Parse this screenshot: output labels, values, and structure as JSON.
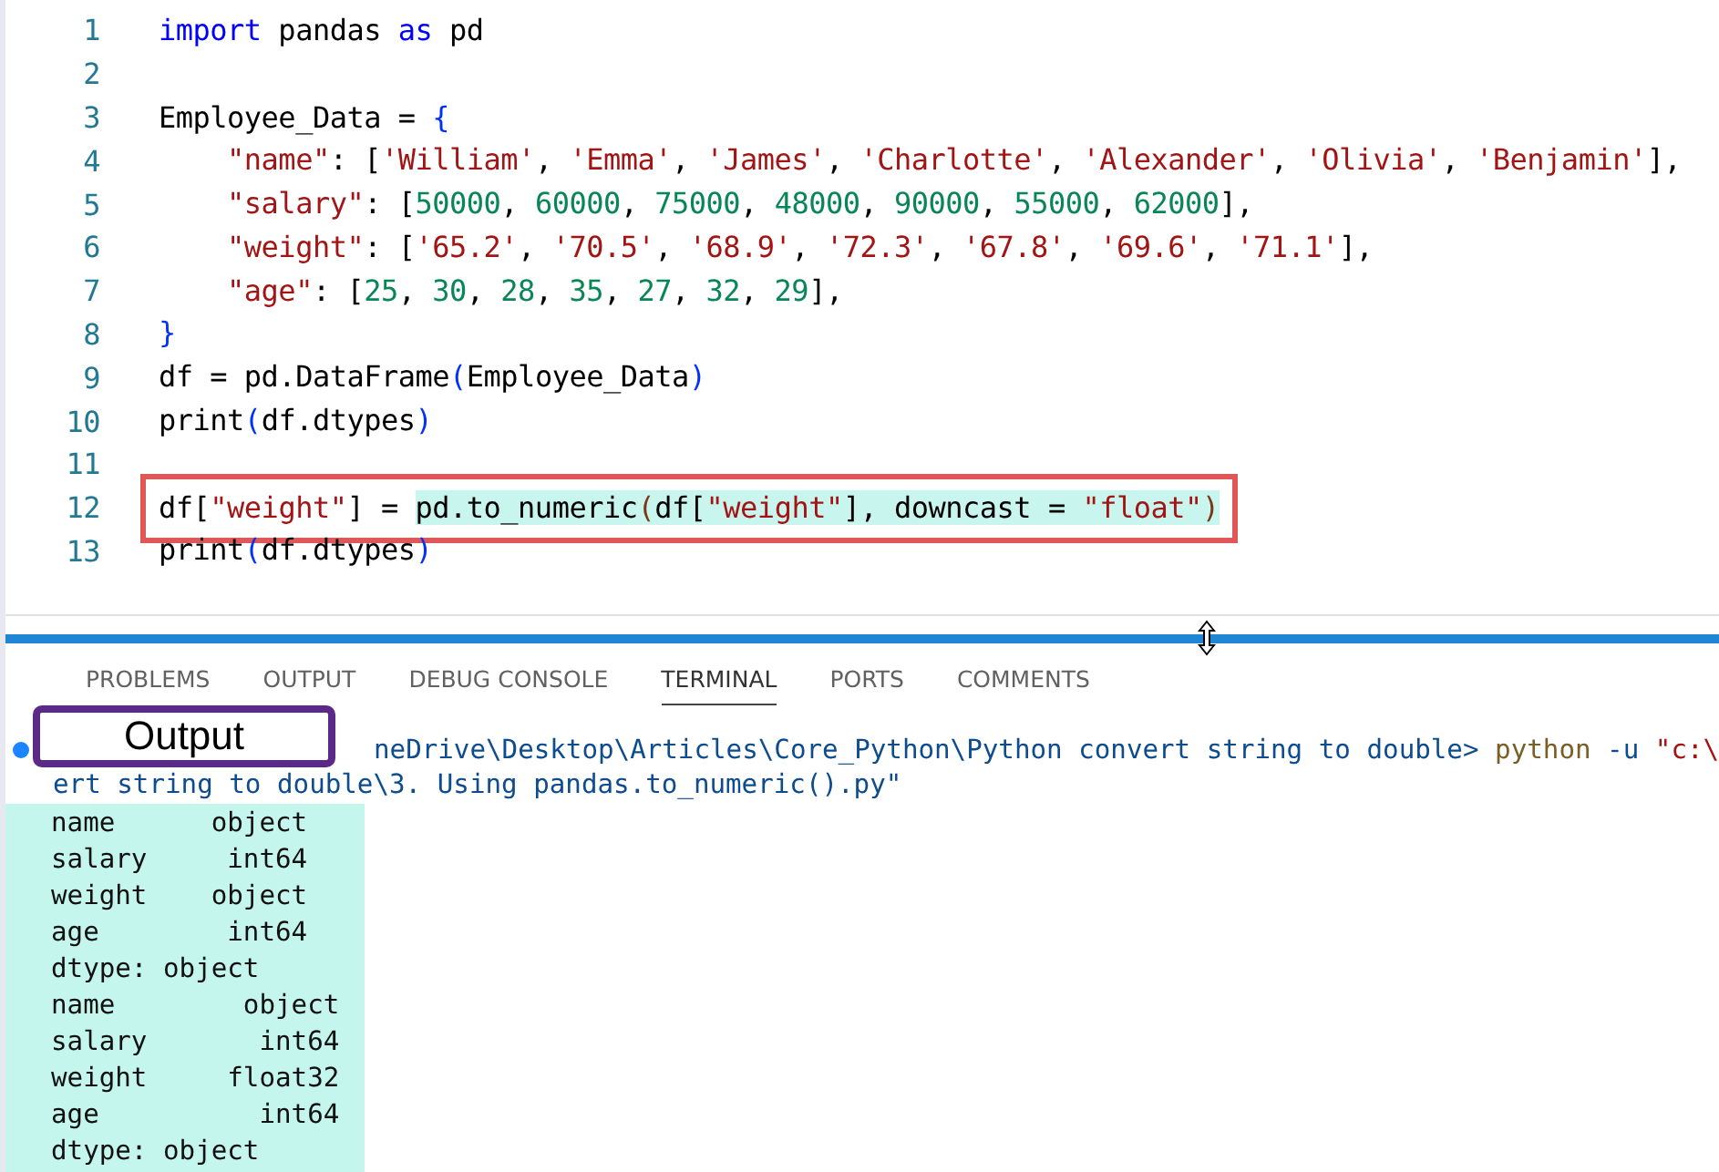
{
  "editor": {
    "lines": [
      {
        "number": "1",
        "boxed": false,
        "tokens": [
          {
            "text": "import",
            "kind": "keyword"
          },
          {
            "text": " pandas ",
            "kind": "plain"
          },
          {
            "text": "as",
            "kind": "keyword"
          },
          {
            "text": " pd",
            "kind": "plain"
          }
        ]
      },
      {
        "number": "2",
        "boxed": false
      },
      {
        "number": "3",
        "boxed": false,
        "tokens": [
          {
            "text": "Employee_Data = ",
            "kind": "plain"
          },
          {
            "text": "{",
            "kind": "bracket"
          }
        ]
      },
      {
        "number": "4",
        "boxed": false,
        "tokens": [
          {
            "text": "    \"name\"",
            "kind": "string"
          },
          {
            "text": ": [",
            "kind": "plain"
          },
          {
            "text": "'William'",
            "kind": "string"
          },
          {
            "text": ", ",
            "kind": "plain"
          },
          {
            "text": "'Emma'",
            "kind": "string"
          },
          {
            "text": ", ",
            "kind": "plain"
          },
          {
            "text": "'James'",
            "kind": "string"
          },
          {
            "text": ", ",
            "kind": "plain"
          },
          {
            "text": "'Charlotte'",
            "kind": "string"
          },
          {
            "text": ", ",
            "kind": "plain"
          },
          {
            "text": "'Alexander'",
            "kind": "string"
          },
          {
            "text": ", ",
            "kind": "plain"
          },
          {
            "text": "'Olivia'",
            "kind": "string"
          },
          {
            "text": ", ",
            "kind": "plain"
          },
          {
            "text": "'Benjamin'",
            "kind": "string"
          },
          {
            "text": "],",
            "kind": "plain"
          }
        ]
      },
      {
        "number": "5",
        "boxed": false,
        "tokens": [
          {
            "text": "    \"salary\"",
            "kind": "string"
          },
          {
            "text": ": [",
            "kind": "plain"
          },
          {
            "text": "50000",
            "kind": "number"
          },
          {
            "text": ", ",
            "kind": "plain"
          },
          {
            "text": "60000",
            "kind": "number"
          },
          {
            "text": ", ",
            "kind": "plain"
          },
          {
            "text": "75000",
            "kind": "number"
          },
          {
            "text": ", ",
            "kind": "plain"
          },
          {
            "text": "48000",
            "kind": "number"
          },
          {
            "text": ", ",
            "kind": "plain"
          },
          {
            "text": "90000",
            "kind": "number"
          },
          {
            "text": ", ",
            "kind": "plain"
          },
          {
            "text": "55000",
            "kind": "number"
          },
          {
            "text": ", ",
            "kind": "plain"
          },
          {
            "text": "62000",
            "kind": "number"
          },
          {
            "text": "],",
            "kind": "plain"
          }
        ]
      },
      {
        "number": "6",
        "boxed": false,
        "tokens": [
          {
            "text": "    \"weight\"",
            "kind": "string"
          },
          {
            "text": ": [",
            "kind": "plain"
          },
          {
            "text": "'65.2'",
            "kind": "string"
          },
          {
            "text": ", ",
            "kind": "plain"
          },
          {
            "text": "'70.5'",
            "kind": "string"
          },
          {
            "text": ", ",
            "kind": "plain"
          },
          {
            "text": "'68.9'",
            "kind": "string"
          },
          {
            "text": ", ",
            "kind": "plain"
          },
          {
            "text": "'72.3'",
            "kind": "string"
          },
          {
            "text": ", ",
            "kind": "plain"
          },
          {
            "text": "'67.8'",
            "kind": "string"
          },
          {
            "text": ", ",
            "kind": "plain"
          },
          {
            "text": "'69.6'",
            "kind": "string"
          },
          {
            "text": ", ",
            "kind": "plain"
          },
          {
            "text": "'71.1'",
            "kind": "string"
          },
          {
            "text": "],",
            "kind": "plain"
          }
        ]
      },
      {
        "number": "7",
        "boxed": false,
        "tokens": [
          {
            "text": "    \"age\"",
            "kind": "string"
          },
          {
            "text": ": [",
            "kind": "plain"
          },
          {
            "text": "25",
            "kind": "number"
          },
          {
            "text": ", ",
            "kind": "plain"
          },
          {
            "text": "30",
            "kind": "number"
          },
          {
            "text": ", ",
            "kind": "plain"
          },
          {
            "text": "28",
            "kind": "number"
          },
          {
            "text": ", ",
            "kind": "plain"
          },
          {
            "text": "35",
            "kind": "number"
          },
          {
            "text": ", ",
            "kind": "plain"
          },
          {
            "text": "27",
            "kind": "number"
          },
          {
            "text": ", ",
            "kind": "plain"
          },
          {
            "text": "32",
            "kind": "number"
          },
          {
            "text": ", ",
            "kind": "plain"
          },
          {
            "text": "29",
            "kind": "number"
          },
          {
            "text": "],",
            "kind": "plain"
          }
        ]
      },
      {
        "number": "8",
        "boxed": false,
        "tokens": [
          {
            "text": "}",
            "kind": "bracket"
          }
        ]
      },
      {
        "number": "9",
        "boxed": false,
        "tokens": [
          {
            "text": "df = pd.DataFrame",
            "kind": "plain"
          },
          {
            "text": "(",
            "kind": "bracket"
          },
          {
            "text": "Employee_Data",
            "kind": "plain"
          },
          {
            "text": ")",
            "kind": "bracket"
          }
        ]
      },
      {
        "number": "10",
        "boxed": false,
        "tokens": [
          {
            "text": "print",
            "kind": "plain"
          },
          {
            "text": "(",
            "kind": "bracket"
          },
          {
            "text": "df.dtypes",
            "kind": "plain"
          },
          {
            "text": ")",
            "kind": "bracket"
          }
        ]
      },
      {
        "number": "11",
        "boxed": false
      },
      {
        "number": "12",
        "boxed": true,
        "tokens": [
          {
            "text": "df[",
            "kind": "plain",
            "highlight": false
          },
          {
            "text": "\"weight\"",
            "kind": "string",
            "highlight": false
          },
          {
            "text": "] = ",
            "kind": "plain",
            "highlight": false
          },
          {
            "text": "pd.to_numeric",
            "kind": "plain",
            "highlight": true
          },
          {
            "text": "(",
            "kind": "bracket2",
            "highlight": true
          },
          {
            "text": "df[",
            "kind": "plain",
            "highlight": true
          },
          {
            "text": "\"weight\"",
            "kind": "string",
            "highlight": true
          },
          {
            "text": "], downcast = ",
            "kind": "plain",
            "highlight": true
          },
          {
            "text": "\"float\"",
            "kind": "string",
            "highlight": true
          },
          {
            "text": ")",
            "kind": "bracket2",
            "highlight": true
          }
        ]
      },
      {
        "number": "13",
        "boxed": false,
        "tokens": [
          {
            "text": "print",
            "kind": "plain"
          },
          {
            "text": "(",
            "kind": "bracket"
          },
          {
            "text": "df.dtypes",
            "kind": "plain"
          },
          {
            "text": ")",
            "kind": "bracket"
          }
        ]
      }
    ]
  },
  "panel": {
    "tabs": [
      {
        "label": "PROBLEMS",
        "selected": false
      },
      {
        "label": "OUTPUT",
        "selected": false
      },
      {
        "label": "DEBUG CONSOLE",
        "selected": false
      },
      {
        "label": "TERMINAL",
        "selected": true
      },
      {
        "label": "PORTS",
        "selected": false
      },
      {
        "label": "COMMENTS",
        "selected": false
      }
    ],
    "callout": "Output",
    "command": [
      {
        "text": "neDrive\\Desktop\\Articles\\Core_Python\\Python convert string to double> ",
        "kind": "plain"
      },
      {
        "text": "python",
        "kind": "command"
      },
      {
        "text": " -u ",
        "kind": "plain"
      },
      {
        "text": "\"c:\\",
        "kind": "string"
      }
    ],
    "command_continued": "ert string to double\\3. Using pandas.to_numeric().py\"",
    "output": [
      "name      object",
      "salary     int64",
      "weight    object",
      "age        int64",
      "dtype: object",
      "name        object",
      "salary       int64",
      "weight     float32",
      "age          int64",
      "dtype: object"
    ]
  }
}
